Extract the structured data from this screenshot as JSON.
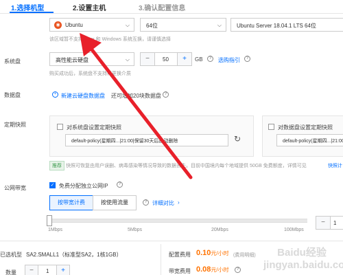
{
  "steps": [
    "1.选择机型",
    "2.设置主机",
    "3.确认配置信息"
  ],
  "os": {
    "distro": "Ubuntu",
    "arch": "64位",
    "version": "Ubuntu Server 18.04.1 LTS 64位",
    "hint": "该区域暂不支持Linux 和 Windows 系统互换，请谨慎选择"
  },
  "system_disk": {
    "label": "系统盘",
    "type": "高性能云硬盘",
    "size": "50",
    "unit": "GB",
    "guide_link": "选购指引",
    "hint": "购买成功后，系统盘不支持再更换介质"
  },
  "data_disk": {
    "label": "数据盘",
    "add_link": "新建云硬盘数据盘",
    "extra": "还可增加20块数据盘"
  },
  "snapshot": {
    "label": "定期快照",
    "sys_checkbox": "对系统盘设置定期快照",
    "sys_policy": "default-policy(星期四...|21:00|保留30天后自动删除",
    "data_checkbox": "对数据盘设置定期快照",
    "data_policy": "default-policy(星期四...|21:00|保",
    "tag": "推荐",
    "tip": "快照可恢复由用户误删、病毒感染等情况导致的数据丢失。目前中国境内每个地域提供 50GB 免费额度，详情可见",
    "tip_link": "快照计"
  },
  "bandwidth": {
    "label": "公网带宽",
    "free_ip": "免费分配独立公网IP",
    "by_bandwidth": "按带宽计费",
    "by_traffic": "按使用流量",
    "compare_link": "详细对比",
    "ticks": [
      "1Mbps",
      "5Mbps",
      "20Mbps",
      "100Mbps"
    ],
    "slider_value": 1,
    "slider_max": 100,
    "input_value": "1"
  },
  "footer": {
    "model_label": "已选机型",
    "model_value": "SA2.SMALL1（标准型SA2，1核1GB）",
    "qty_label": "数量",
    "qty_value": "1",
    "config_fee_label": "配置费用",
    "config_fee": "0.10",
    "config_fee_unit": "元/小时",
    "config_fee_note": "(费用明细)",
    "bw_fee_label": "带宽费用",
    "bw_fee": "0.08",
    "bw_fee_unit": "元/小时"
  },
  "watermark": "Baidu经验 jingyan.baidu.com",
  "colors": {
    "accent": "#006eff",
    "price": "#ff7200",
    "annotation_arrow": "#e8202a"
  }
}
